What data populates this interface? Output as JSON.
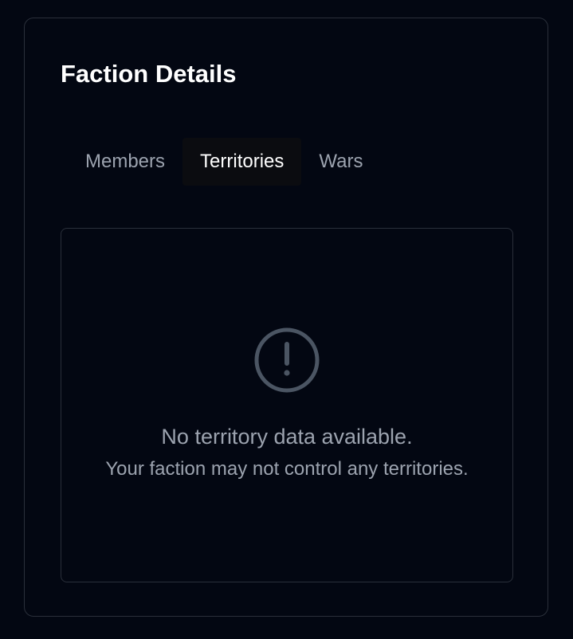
{
  "card": {
    "title": "Faction Details"
  },
  "tabs": [
    {
      "label": "Members",
      "active": false
    },
    {
      "label": "Territories",
      "active": true
    },
    {
      "label": "Wars",
      "active": false
    }
  ],
  "empty_state": {
    "icon": "alert-circle-icon",
    "title": "No territory data available.",
    "subtitle": "Your faction may not control any territories."
  },
  "colors": {
    "background": "#030712",
    "border": "#2a2f3a",
    "active_tab_bg": "#0b0c10",
    "muted_text": "#9ca3af",
    "icon": "#4b5563"
  }
}
